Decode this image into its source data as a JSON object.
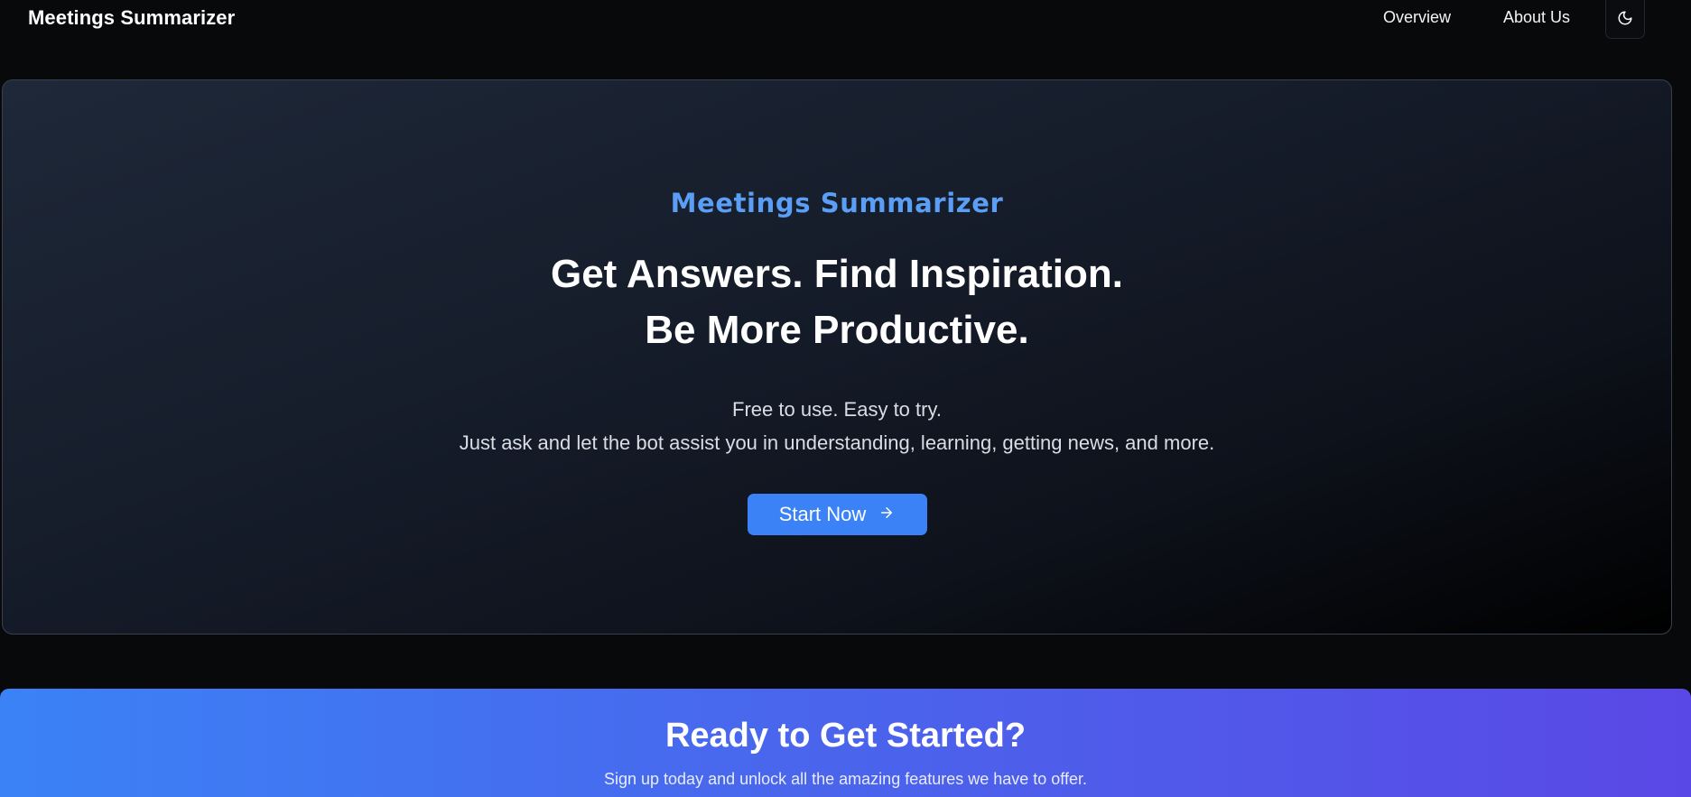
{
  "navbar": {
    "brand": "Meetings Summarizer",
    "links": [
      "Overview",
      "About Us"
    ],
    "theme_toggle_icon": "moon-icon"
  },
  "hero": {
    "kicker": "Meetings Summarizer",
    "title_line1": "Get Answers. Find Inspiration.",
    "title_line2": "Be More Productive.",
    "subtitle_line1": "Free to use. Easy to try.",
    "subtitle_line2": "Just ask and let the bot assist you in understanding, learning, getting news, and more.",
    "cta_label": "Start Now",
    "cta_icon": "arrow-right-icon"
  },
  "cta_section": {
    "title": "Ready to Get Started?",
    "text": "Sign up today and unlock all the amazing features we have to offer."
  },
  "colors": {
    "accent": "#3b82f6",
    "kicker": "#5b9ef5",
    "background": "#08090b",
    "cta_gradient_end": "#5a48e6"
  }
}
